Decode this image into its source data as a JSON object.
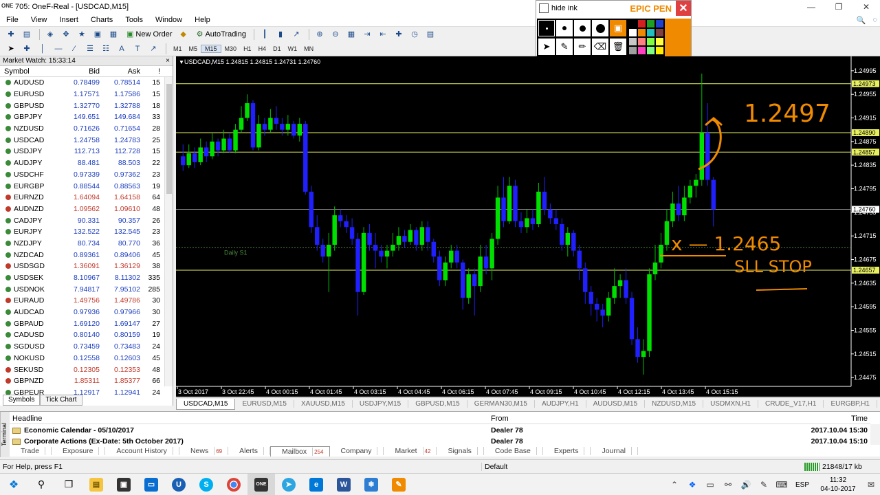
{
  "window": {
    "title": "705: OneF-Real - [USDCAD,M15]",
    "app_icon_text": "ONE"
  },
  "menu": [
    "File",
    "View",
    "Insert",
    "Charts",
    "Tools",
    "Window",
    "Help"
  ],
  "toolbar": {
    "new_order": "New Order",
    "autotrading": "AutoTrading",
    "timeframes": [
      "M1",
      "M5",
      "M15",
      "M30",
      "H1",
      "H4",
      "D1",
      "W1",
      "MN"
    ],
    "active_timeframe": "M15"
  },
  "epic_pen": {
    "hide_ink": "hide ink",
    "brand": "EPIC PEN",
    "colors": [
      "#000000",
      "#d42020",
      "#20a020",
      "#2040d0",
      "#ffffff",
      "#f08a00",
      "#20c0c0",
      "#804040",
      "#c8c8c8",
      "#ff8080",
      "#80ff40",
      "#ffff40",
      "#a0a0a0",
      "#ff40c0",
      "#80ff80",
      "#ffee00"
    ]
  },
  "market_watch": {
    "title": "Market Watch: 15:33:14",
    "headers": {
      "symbol": "Symbol",
      "bid": "Bid",
      "ask": "Ask",
      "spread": "!"
    },
    "rows": [
      {
        "symbol": "AUDUSD",
        "bid": "0.78499",
        "ask": "0.78514",
        "spread": "15",
        "dir": "up"
      },
      {
        "symbol": "EURUSD",
        "bid": "1.17571",
        "ask": "1.17586",
        "spread": "15",
        "dir": "up"
      },
      {
        "symbol": "GBPUSD",
        "bid": "1.32770",
        "ask": "1.32788",
        "spread": "18",
        "dir": "up"
      },
      {
        "symbol": "GBPJPY",
        "bid": "149.651",
        "ask": "149.684",
        "spread": "33",
        "dir": "up"
      },
      {
        "symbol": "NZDUSD",
        "bid": "0.71626",
        "ask": "0.71654",
        "spread": "28",
        "dir": "up"
      },
      {
        "symbol": "USDCAD",
        "bid": "1.24758",
        "ask": "1.24783",
        "spread": "25",
        "dir": "up"
      },
      {
        "symbol": "USDJPY",
        "bid": "112.713",
        "ask": "112.728",
        "spread": "15",
        "dir": "up"
      },
      {
        "symbol": "AUDJPY",
        "bid": "88.481",
        "ask": "88.503",
        "spread": "22",
        "dir": "up"
      },
      {
        "symbol": "USDCHF",
        "bid": "0.97339",
        "ask": "0.97362",
        "spread": "23",
        "dir": "up"
      },
      {
        "symbol": "EURGBP",
        "bid": "0.88544",
        "ask": "0.88563",
        "spread": "19",
        "dir": "up"
      },
      {
        "symbol": "EURNZD",
        "bid": "1.64094",
        "ask": "1.64158",
        "spread": "64",
        "dir": "dn"
      },
      {
        "symbol": "AUDNZD",
        "bid": "1.09562",
        "ask": "1.09610",
        "spread": "48",
        "dir": "dn"
      },
      {
        "symbol": "CADJPY",
        "bid": "90.331",
        "ask": "90.357",
        "spread": "26",
        "dir": "up"
      },
      {
        "symbol": "EURJPY",
        "bid": "132.522",
        "ask": "132.545",
        "spread": "23",
        "dir": "up"
      },
      {
        "symbol": "NZDJPY",
        "bid": "80.734",
        "ask": "80.770",
        "spread": "36",
        "dir": "up"
      },
      {
        "symbol": "NZDCAD",
        "bid": "0.89361",
        "ask": "0.89406",
        "spread": "45",
        "dir": "up"
      },
      {
        "symbol": "USDSGD",
        "bid": "1.36091",
        "ask": "1.36129",
        "spread": "38",
        "dir": "dn"
      },
      {
        "symbol": "USDSEK",
        "bid": "8.10967",
        "ask": "8.11302",
        "spread": "335",
        "dir": "up"
      },
      {
        "symbol": "USDNOK",
        "bid": "7.94817",
        "ask": "7.95102",
        "spread": "285",
        "dir": "up"
      },
      {
        "symbol": "EURAUD",
        "bid": "1.49756",
        "ask": "1.49786",
        "spread": "30",
        "dir": "dn"
      },
      {
        "symbol": "AUDCAD",
        "bid": "0.97936",
        "ask": "0.97966",
        "spread": "30",
        "dir": "up"
      },
      {
        "symbol": "GBPAUD",
        "bid": "1.69120",
        "ask": "1.69147",
        "spread": "27",
        "dir": "up"
      },
      {
        "symbol": "CADUSD",
        "bid": "0.80140",
        "ask": "0.80159",
        "spread": "19",
        "dir": "up"
      },
      {
        "symbol": "SGDUSD",
        "bid": "0.73459",
        "ask": "0.73483",
        "spread": "24",
        "dir": "up"
      },
      {
        "symbol": "NOKUSD",
        "bid": "0.12558",
        "ask": "0.12603",
        "spread": "45",
        "dir": "up"
      },
      {
        "symbol": "SEKUSD",
        "bid": "0.12305",
        "ask": "0.12353",
        "spread": "48",
        "dir": "dn"
      },
      {
        "symbol": "GBPNZD",
        "bid": "1.85311",
        "ask": "1.85377",
        "spread": "66",
        "dir": "dn"
      },
      {
        "symbol": "GBPEUR",
        "bid": "1.12917",
        "ask": "1.12941",
        "spread": "24",
        "dir": "up"
      }
    ],
    "tabs": [
      "Symbols",
      "Tick Chart"
    ]
  },
  "chart_data": {
    "type": "candlestick",
    "header": "USDCAD,M15  1.24815 1.24815 1.24731 1.24760",
    "price_ticks": [
      "1.24995",
      "1.24955",
      "1.24915",
      "1.24875",
      "1.24835",
      "1.24795",
      "1.24755",
      "1.24715",
      "1.24675",
      "1.24635",
      "1.24595",
      "1.24555",
      "1.24515",
      "1.24475"
    ],
    "ylim": [
      1.2446,
      1.2501
    ],
    "time_ticks": [
      "3 Oct 2017",
      "3 Oct 22:45",
      "4 Oct 00:15",
      "4 Oct 01:45",
      "4 Oct 03:15",
      "4 Oct 04:45",
      "4 Oct 06:15",
      "4 Oct 07:45",
      "4 Oct 09:15",
      "4 Oct 10:45",
      "4 Oct 12:15",
      "4 Oct 13:45",
      "4 Oct 15:15"
    ],
    "levels": [
      {
        "price": 1.24973,
        "label": "1.24973"
      },
      {
        "price": 1.2489,
        "label": "1.24890"
      },
      {
        "price": 1.24857,
        "label": "1.24857"
      },
      {
        "price": 1.24657,
        "label": "1.24657"
      }
    ],
    "current_price": {
      "price": 1.2476,
      "label": "1.24760"
    },
    "pivot": {
      "price": 1.24695,
      "label": "Daily S1"
    },
    "candles": [
      [
        1.2485,
        1.24835,
        1.2487,
        1.24825
      ],
      [
        1.24835,
        1.24855,
        1.2487,
        1.2483
      ],
      [
        1.24855,
        1.2484,
        1.24865,
        1.2483
      ],
      [
        1.2484,
        1.24865,
        1.2488,
        1.24835
      ],
      [
        1.24865,
        1.2485,
        1.24875,
        1.2484
      ],
      [
        1.2485,
        1.24875,
        1.2489,
        1.24845
      ],
      [
        1.24875,
        1.2486,
        1.2488,
        1.2485
      ],
      [
        1.2486,
        1.2488,
        1.24895,
        1.24855
      ],
      [
        1.2488,
        1.2486,
        1.2489,
        1.24855
      ],
      [
        1.2486,
        1.24895,
        1.24905,
        1.24855
      ],
      [
        1.24895,
        1.24915,
        1.24935,
        1.2489
      ],
      [
        1.24915,
        1.2494,
        1.24955,
        1.2491
      ],
      [
        1.2494,
        1.24865,
        1.24945,
        1.2486
      ],
      [
        1.24865,
        1.24905,
        1.2492,
        1.2486
      ],
      [
        1.24905,
        1.24895,
        1.24915,
        1.24885
      ],
      [
        1.24895,
        1.24915,
        1.2493,
        1.2489
      ],
      [
        1.24915,
        1.24905,
        1.24935,
        1.24895
      ],
      [
        1.24905,
        1.24895,
        1.24915,
        1.24885
      ],
      [
        1.24895,
        1.24905,
        1.2492,
        1.24885
      ],
      [
        1.24905,
        1.24885,
        1.2491,
        1.2488
      ],
      [
        1.24885,
        1.24905,
        1.24915,
        1.24875
      ],
      [
        1.24905,
        1.2479,
        1.2491,
        1.24785
      ],
      [
        1.2479,
        1.2473,
        1.248,
        1.2472
      ],
      [
        1.2473,
        1.247,
        1.2475,
        1.2469
      ],
      [
        1.247,
        1.2468,
        1.2471,
        1.2467
      ],
      [
        1.2468,
        1.247,
        1.2472,
        1.2462
      ],
      [
        1.247,
        1.2475,
        1.24765,
        1.2469
      ],
      [
        1.2475,
        1.2474,
        1.2476,
        1.2473
      ],
      [
        1.2474,
        1.2473,
        1.2475,
        1.2472
      ],
      [
        1.2473,
        1.2471,
        1.24745,
        1.247
      ],
      [
        1.2471,
        1.2462,
        1.2472,
        1.2458
      ],
      [
        1.2462,
        1.2472,
        1.2473,
        1.24615
      ],
      [
        1.2472,
        1.247,
        1.24735,
        1.2469
      ],
      [
        1.247,
        1.2469,
        1.2472,
        1.2466
      ],
      [
        1.2469,
        1.2468,
        1.247,
        1.2467
      ],
      [
        1.2468,
        1.2469,
        1.247,
        1.2466
      ],
      [
        1.2469,
        1.247,
        1.2472,
        1.2468
      ],
      [
        1.247,
        1.24715,
        1.2473,
        1.2469
      ],
      [
        1.24715,
        1.24705,
        1.24725,
        1.24695
      ],
      [
        1.24705,
        1.24725,
        1.24735,
        1.247
      ],
      [
        1.24725,
        1.247,
        1.2473,
        1.2469
      ],
      [
        1.247,
        1.2473,
        1.2474,
        1.2469
      ],
      [
        1.2473,
        1.24705,
        1.2474,
        1.2469
      ],
      [
        1.24705,
        1.2468,
        1.2471,
        1.2467
      ],
      [
        1.2468,
        1.2464,
        1.2469,
        1.2463
      ],
      [
        1.2464,
        1.2467,
        1.2468,
        1.2463
      ],
      [
        1.2467,
        1.2469,
        1.247,
        1.2466
      ],
      [
        1.2469,
        1.2467,
        1.247,
        1.2466
      ],
      [
        1.2467,
        1.2461,
        1.24675,
        1.2459
      ],
      [
        1.2461,
        1.2465,
        1.2466,
        1.246
      ],
      [
        1.2465,
        1.2463,
        1.2466,
        1.2458
      ],
      [
        1.2463,
        1.2468,
        1.247,
        1.2462
      ],
      [
        1.2468,
        1.2466,
        1.247,
        1.2465
      ],
      [
        1.2466,
        1.2471,
        1.2472,
        1.2464
      ],
      [
        1.2471,
        1.2478,
        1.248,
        1.247
      ],
      [
        1.2478,
        1.2474,
        1.24815,
        1.2473
      ],
      [
        1.2474,
        1.248,
        1.24815,
        1.24735
      ],
      [
        1.248,
        1.2474,
        1.2481,
        1.2473
      ],
      [
        1.2474,
        1.2473,
        1.24755,
        1.2472
      ],
      [
        1.2473,
        1.24745,
        1.2476,
        1.2472
      ],
      [
        1.24745,
        1.24735,
        1.2476,
        1.24725
      ],
      [
        1.24735,
        1.2479,
        1.24805,
        1.2473
      ],
      [
        1.2479,
        1.2476,
        1.24815,
        1.2475
      ],
      [
        1.2476,
        1.24745,
        1.2477,
        1.24735
      ],
      [
        1.24745,
        1.24735,
        1.2476,
        1.24725
      ],
      [
        1.24735,
        1.247,
        1.24745,
        1.2469
      ],
      [
        1.247,
        1.2472,
        1.2473,
        1.2468
      ],
      [
        1.2472,
        1.2469,
        1.24725,
        1.2468
      ],
      [
        1.2469,
        1.2466,
        1.247,
        1.2464
      ],
      [
        1.2466,
        1.2462,
        1.2467,
        1.246
      ],
      [
        1.2462,
        1.246,
        1.2463,
        1.2458
      ],
      [
        1.246,
        1.2459,
        1.2461,
        1.2457
      ],
      [
        1.2459,
        1.2458,
        1.246,
        1.2456
      ],
      [
        1.2458,
        1.2461,
        1.2462,
        1.2457
      ],
      [
        1.2461,
        1.2463,
        1.2466,
        1.246
      ],
      [
        1.2463,
        1.2464,
        1.2465,
        1.2461
      ],
      [
        1.2464,
        1.2461,
        1.2466,
        1.246
      ],
      [
        1.2461,
        1.2454,
        1.2462,
        1.2453
      ],
      [
        1.2454,
        1.2451,
        1.2456,
        1.245
      ],
      [
        1.2451,
        1.2452,
        1.2454,
        1.2448
      ],
      [
        1.2452,
        1.2465,
        1.2466,
        1.2451
      ],
      [
        1.2465,
        1.2467,
        1.247,
        1.2464
      ],
      [
        1.2467,
        1.247,
        1.2472,
        1.2466
      ],
      [
        1.247,
        1.2474,
        1.2476,
        1.2469
      ],
      [
        1.2474,
        1.2477,
        1.2479,
        1.2473
      ],
      [
        1.2477,
        1.2475,
        1.248,
        1.2474
      ],
      [
        1.2475,
        1.2478,
        1.248,
        1.2474
      ],
      [
        1.2478,
        1.248,
        1.2481,
        1.2477
      ],
      [
        1.248,
        1.2481,
        1.2482,
        1.2478
      ],
      [
        1.2481,
        1.2489,
        1.2499,
        1.248
      ],
      [
        1.2489,
        1.2481,
        1.2494,
        1.248
      ],
      [
        1.2481,
        1.2476,
        1.24815,
        1.24731
      ]
    ]
  },
  "annotations": {
    "handwriting_1": "1.2497",
    "handwriting_2": "x — 1.2465",
    "handwriting_3": "SLL STOP"
  },
  "chart_tabs": [
    "USDCAD,M15",
    "EURUSD,M15",
    "XAUUSD,M15",
    "USDJPY,M15",
    "GBPUSD,M15",
    "GERMAN30,M15",
    "AUDJPY,H1",
    "AUDUSD,M15",
    "NZDUSD,M15",
    "USDMXN,H1",
    "CRUDE_V17,H1",
    "EURGBP,H1"
  ],
  "active_chart_tab": "USDCAD,M15",
  "terminal": {
    "side_label": "Terminal",
    "headers": {
      "headline": "Headline",
      "from": "From",
      "time": "Time"
    },
    "rows": [
      {
        "headline": "Economic Calendar - 05/10/2017",
        "from": "Dealer 78",
        "time": "2017.10.04 15:30"
      },
      {
        "headline": "Corporate Actions (Ex-Date: 5th October 2017)",
        "from": "Dealer 78",
        "time": "2017.10.04 15:10"
      }
    ],
    "tabs": [
      {
        "label": "Trade",
        "badge": ""
      },
      {
        "label": "Exposure",
        "badge": ""
      },
      {
        "label": "Account History",
        "badge": ""
      },
      {
        "label": "News",
        "badge": "69"
      },
      {
        "label": "Alerts",
        "badge": ""
      },
      {
        "label": "Mailbox",
        "badge": "254"
      },
      {
        "label": "Company",
        "badge": ""
      },
      {
        "label": "Market",
        "badge": "42"
      },
      {
        "label": "Signals",
        "badge": ""
      },
      {
        "label": "Code Base",
        "badge": ""
      },
      {
        "label": "Experts",
        "badge": ""
      },
      {
        "label": "Journal",
        "badge": ""
      }
    ],
    "active_tab": "Mailbox"
  },
  "statusbar": {
    "help": "For Help, press F1",
    "profile": "Default",
    "traffic": "21848/17 kb"
  },
  "taskbar": {
    "lang": "ESP",
    "time": "11:32",
    "date": "04-10-2017",
    "notif_badge": "105"
  }
}
